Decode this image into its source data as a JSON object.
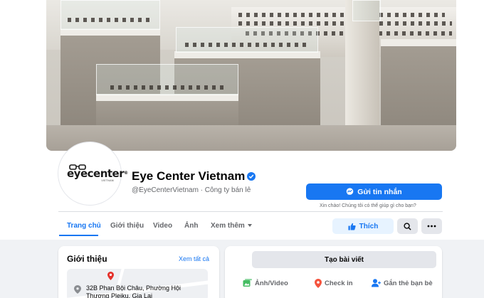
{
  "page": {
    "name": "Eye Center Vietnam",
    "handle": "@EyeCenterVietnam · Công ty bán lẻ",
    "logo": {
      "brand": "eyecenter",
      "reg": "®",
      "sub": "VIETNAM"
    },
    "verified_color": "#1877f2"
  },
  "actions": {
    "message_label": "Gửi tin nhắn",
    "message_hint": "Xin chào! Chúng tôi có thể giúp gì cho bạn?",
    "like_label": "Thích",
    "search_icon": "search-icon",
    "more_icon": "more-horizontal-icon"
  },
  "tabs": [
    {
      "label": "Trang chủ",
      "active": true
    },
    {
      "label": "Giới thiệu",
      "active": false
    },
    {
      "label": "Video",
      "active": false
    },
    {
      "label": "Ảnh",
      "active": false
    },
    {
      "label": "Xem thêm",
      "active": false
    }
  ],
  "intro": {
    "title": "Giới thiệu",
    "see_all": "Xem tất cả",
    "address": "32B Phan Bội Châu, Phường Hội Thương Pleiku, Gia Lai"
  },
  "composer": {
    "create_post": "Tạo bài viết",
    "actions": [
      {
        "label": "Ảnh/Video",
        "icon": "photo-video-icon",
        "color": "#45bd62"
      },
      {
        "label": "Check in",
        "icon": "location-pin-icon",
        "color": "#f5533d"
      },
      {
        "label": "Gắn thẻ bạn bè",
        "icon": "tag-friends-icon",
        "color": "#1877f2"
      }
    ]
  },
  "colors": {
    "accent": "#1877f2",
    "background": "#f0f2f5"
  }
}
